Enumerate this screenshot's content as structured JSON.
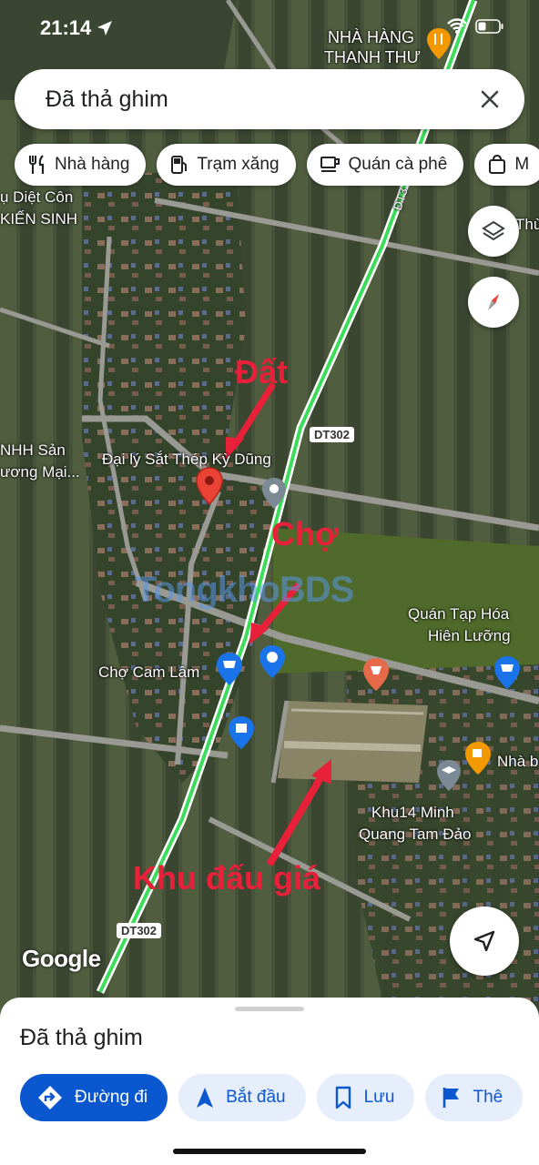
{
  "status_bar": {
    "time": "21:14"
  },
  "search": {
    "query": "Đã thả ghim"
  },
  "chips": [
    {
      "label": "Nhà hàng",
      "icon": "restaurant-icon"
    },
    {
      "label": "Trạm xăng",
      "icon": "gas-station-icon"
    },
    {
      "label": "Quán cà phê",
      "icon": "coffee-icon"
    },
    {
      "label": "M",
      "icon": "shopping-bag-icon"
    }
  ],
  "map": {
    "labels": {
      "nha_hang": "NHÀ HÀNG",
      "thanh_thu": "THANH THƯ",
      "diet_con": "ụ Diệt Côn",
      "kien_sinh": "KIẾN SINH",
      "nhh_san": "NHH Sản",
      "uong_mai": "ương Mại...",
      "dai_ly": "Đại lý Sắt Thép Kỳ Dũng",
      "cho_cam_lam": "Chợ Cam Lâm",
      "quan_tap_hoa_1": "Quán Tạp Hóa",
      "quan_tap_hoa_2": "Hiên Lưỡng",
      "khu14_1": "Khu14 Minh",
      "khu14_2": "Quang Tam Đảo",
      "nha_b": "Nhà b",
      "thu": "Thù",
      "dt3": "ĐT3",
      "dt302_a": "DT302",
      "dt302_b": "DT302"
    },
    "annotations": {
      "dat": "Đất",
      "cho": "Chợ",
      "khu_dau_gia": "Khu đấu giá"
    },
    "watermark": "TongkhoBDS",
    "attribution": "Google"
  },
  "sheet": {
    "title": "Đã thả ghim",
    "actions": [
      {
        "label": "Đường đi",
        "icon": "directions-icon"
      },
      {
        "label": "Bắt đầu",
        "icon": "navigation-arrow-icon"
      },
      {
        "label": "Lưu",
        "icon": "bookmark-icon"
      },
      {
        "label": "Thê",
        "icon": "flag-icon"
      }
    ]
  },
  "colors": {
    "accent": "#0b57d0",
    "annotation": "#e8203a",
    "pin": "#ea4335",
    "road_highlight": "#3ddc5a"
  }
}
